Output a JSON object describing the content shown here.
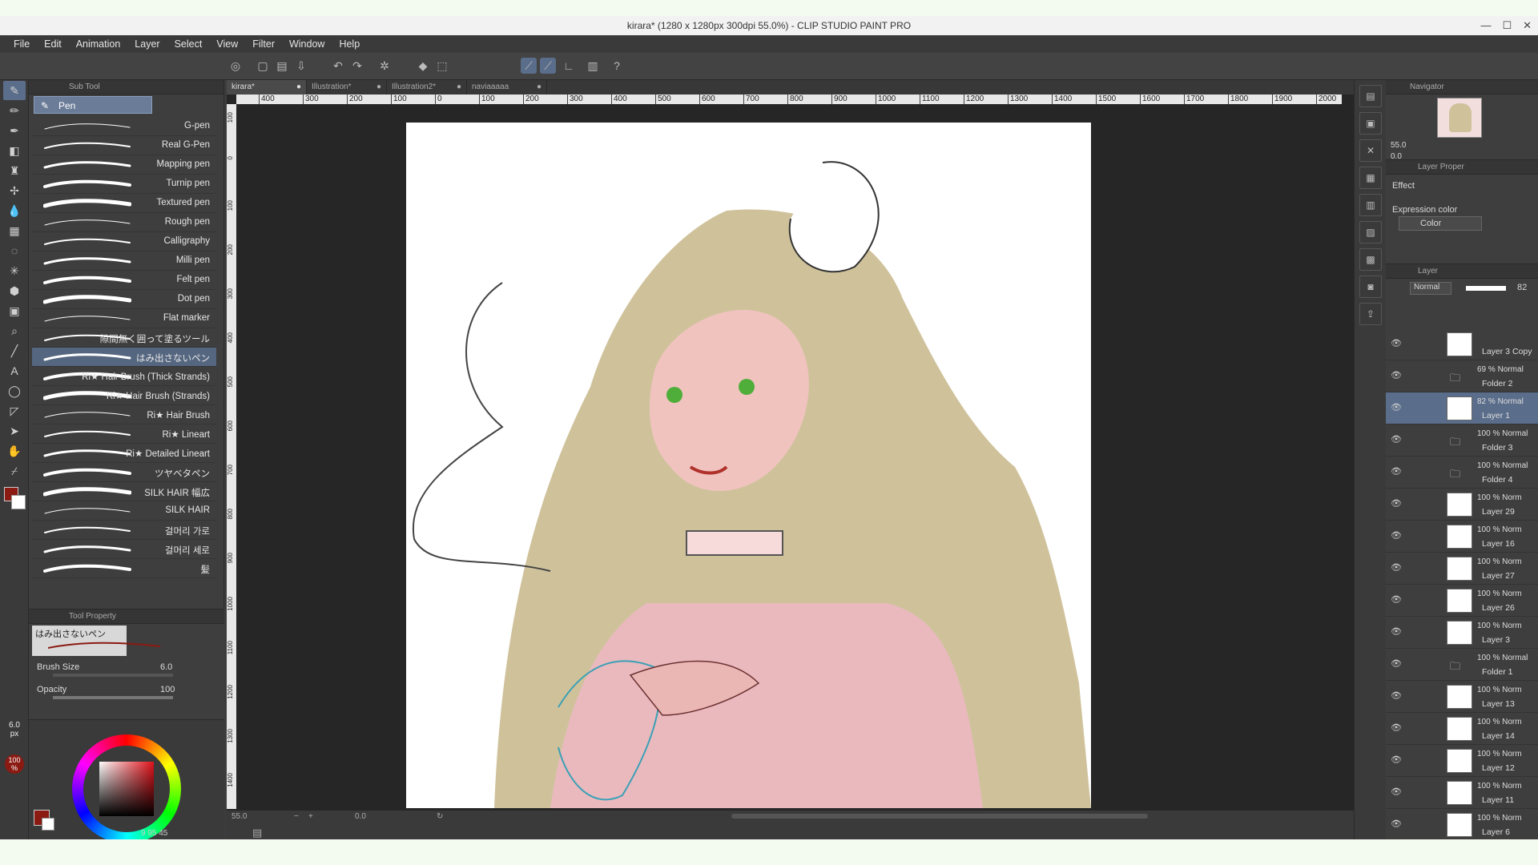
{
  "window": {
    "title": "kirara* (1280 x 1280px 300dpi 55.0%) - CLIP STUDIO PAINT PRO"
  },
  "menu": [
    "File",
    "Edit",
    "Animation",
    "Layer",
    "Select",
    "View",
    "Filter",
    "Window",
    "Help"
  ],
  "subtool": {
    "header": "Sub Tool",
    "active_tab": "Pen",
    "brushes": [
      "G-pen",
      "Real G-Pen",
      "Mapping pen",
      "Turnip pen",
      "Textured pen",
      "Rough pen",
      "Calligraphy",
      "Milli pen",
      "Felt pen",
      "Dot pen",
      "Flat marker",
      "隙間無く囲って塗るツール",
      "はみ出さないペン",
      "Ri★ Hair Brush (Thick Strands)",
      "Ri★ Hair Brush (Strands)",
      "Ri★ Hair Brush",
      "Ri★ Lineart",
      "Ri★ Detailed Lineart",
      "ツヤベタペン",
      "SILK HAIR 幅広",
      "SILK HAIR",
      "걸머리 가로",
      "걸머리 세로",
      "髪"
    ],
    "selected_index": 12
  },
  "tool_property": {
    "header": "Tool Property",
    "preset_name": "はみ出さないペン",
    "brush_size_label": "Brush Size",
    "brush_size_value": "6.0",
    "opacity_label": "Opacity",
    "opacity_value": "100"
  },
  "left_indicators": {
    "size_value": "6.0",
    "size_unit": "px",
    "opacity_value": "100",
    "opacity_unit": "%"
  },
  "color_panel": {
    "main_color": "#8a1a12",
    "sub_color": "#ffffff",
    "values": "9  95  45"
  },
  "tabs": [
    {
      "label": "kirara*",
      "active": true
    },
    {
      "label": "Illustration*",
      "active": false
    },
    {
      "label": "Illustration2*",
      "active": false
    },
    {
      "label": "naviaaaaa",
      "active": false
    }
  ],
  "ruler_h": [
    "400",
    "300",
    "200",
    "100",
    "0",
    "100",
    "200",
    "300",
    "400",
    "500",
    "600",
    "700",
    "800",
    "900",
    "1000",
    "1100",
    "1200",
    "1300",
    "1400",
    "1500",
    "1600",
    "1700",
    "1800",
    "1900",
    "2000"
  ],
  "ruler_v": [
    "100",
    "0",
    "100",
    "200",
    "300",
    "400",
    "500",
    "600",
    "700",
    "800",
    "900",
    "1000",
    "1100",
    "1200",
    "1300",
    "1400"
  ],
  "canvas_status": {
    "zoom": "55.0",
    "angle": "0.0"
  },
  "navigator": {
    "header": "Navigator",
    "zoom": "55.0",
    "angle": "0.0"
  },
  "layer_property": {
    "header": "Layer Proper",
    "effect_label": "Effect",
    "expression_label": "Expression color",
    "expression_value": "Color"
  },
  "layer_panel": {
    "header": "Layer",
    "blend_mode": "Normal",
    "opacity": "82",
    "layers": [
      {
        "mode": "",
        "name": "Layer 3 Copy",
        "type": "layer"
      },
      {
        "mode": "69 % Normal",
        "name": "Folder 2",
        "type": "folder"
      },
      {
        "mode": "82 % Normal",
        "name": "Layer 1",
        "type": "layer",
        "selected": true
      },
      {
        "mode": "100 % Normal",
        "name": "Folder 3",
        "type": "folder"
      },
      {
        "mode": "100 % Normal",
        "name": "Folder 4",
        "type": "folder"
      },
      {
        "mode": "100 % Norm",
        "name": "Layer 29",
        "type": "layer"
      },
      {
        "mode": "100 % Norm",
        "name": "Layer 16",
        "type": "layer"
      },
      {
        "mode": "100 % Norm",
        "name": "Layer 27",
        "type": "layer"
      },
      {
        "mode": "100 % Norm",
        "name": "Layer 26",
        "type": "layer"
      },
      {
        "mode": "100 % Norm",
        "name": "Layer 3",
        "type": "layer"
      },
      {
        "mode": "100 % Normal",
        "name": "Folder 1",
        "type": "folder"
      },
      {
        "mode": "100 % Norm",
        "name": "Layer 13",
        "type": "layer"
      },
      {
        "mode": "100 % Norm",
        "name": "Layer 14",
        "type": "layer"
      },
      {
        "mode": "100 % Norm",
        "name": "Layer 12",
        "type": "layer"
      },
      {
        "mode": "100 % Norm",
        "name": "Layer 11",
        "type": "layer"
      },
      {
        "mode": "100 % Norm",
        "name": "Layer 6",
        "type": "layer"
      }
    ]
  }
}
